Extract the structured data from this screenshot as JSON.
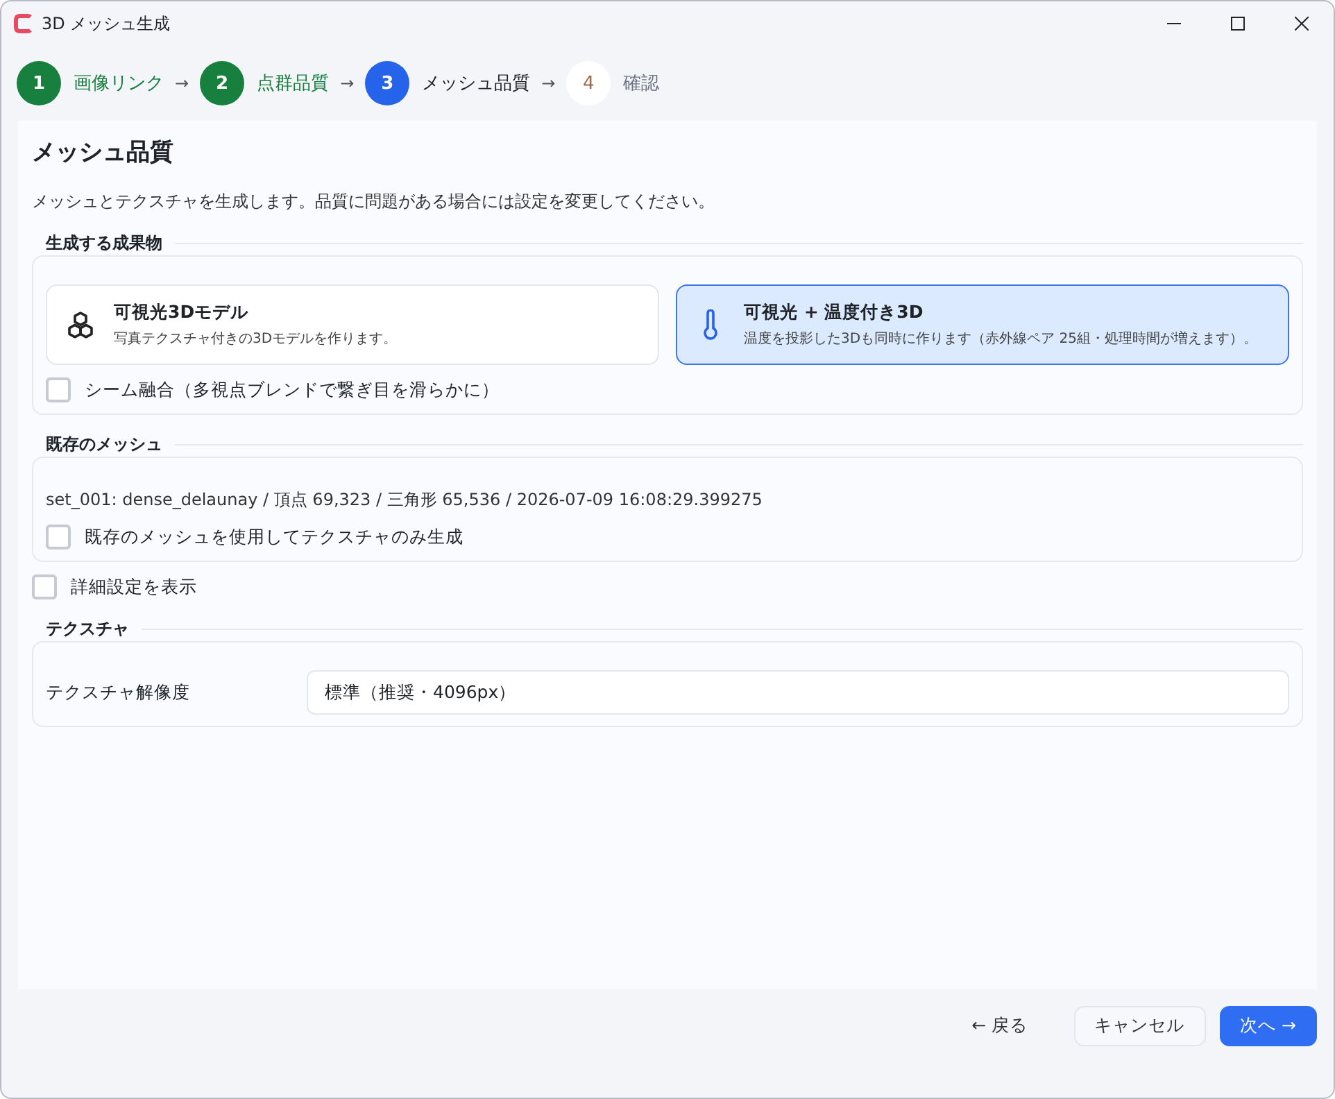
{
  "window": {
    "title": "3D メッシュ生成"
  },
  "steps": [
    {
      "number": "1",
      "label": "画像リンク",
      "done": true,
      "current": false
    },
    {
      "number": "2",
      "label": "点群品質",
      "done": true,
      "current": false
    },
    {
      "number": "3",
      "label": "メッシュ品質",
      "done": false,
      "current": true
    },
    {
      "number": "4",
      "label": "確認",
      "done": false,
      "current": false
    }
  ],
  "step_separator": "→",
  "page": {
    "title": "メッシュ品質",
    "description": "メッシュとテクスチャを生成します。品質に問題がある場合には設定を変更してください。"
  },
  "outputs": {
    "legend": "生成する成果物",
    "options": [
      {
        "kind": "cubes",
        "title": "可視光3Dモデル",
        "subtitle": "写真テクスチャ付きの3Dモデルを作ります。",
        "selected": false
      },
      {
        "kind": "thermometer",
        "title": "可視光 + 温度付き3D",
        "subtitle": "温度を投影した3Dも同時に作ります（赤外線ペア 25組・処理時間が増えます）。",
        "selected": true
      }
    ],
    "seam_blend": {
      "label": "シーム融合（多視点ブレンドで繋ぎ目を滑らかに）",
      "checked": false
    }
  },
  "existing_mesh": {
    "legend": "既存のメッシュ",
    "info": "set_001: dense_delaunay / 頂点 69,323 / 三角形 65,536 / 2026-07-09 16:08:29.399275",
    "reuse": {
      "label": "既存のメッシュを使用してテクスチャのみ生成",
      "checked": false
    }
  },
  "advanced": {
    "label": "詳細設定を表示",
    "checked": false
  },
  "texture": {
    "legend": "テクスチャ",
    "field_label": "テクスチャ解像度",
    "value": "標準（推奨・4096px）"
  },
  "footer": {
    "back": "← 戻る",
    "cancel": "キャンセル",
    "next": "次へ →"
  }
}
